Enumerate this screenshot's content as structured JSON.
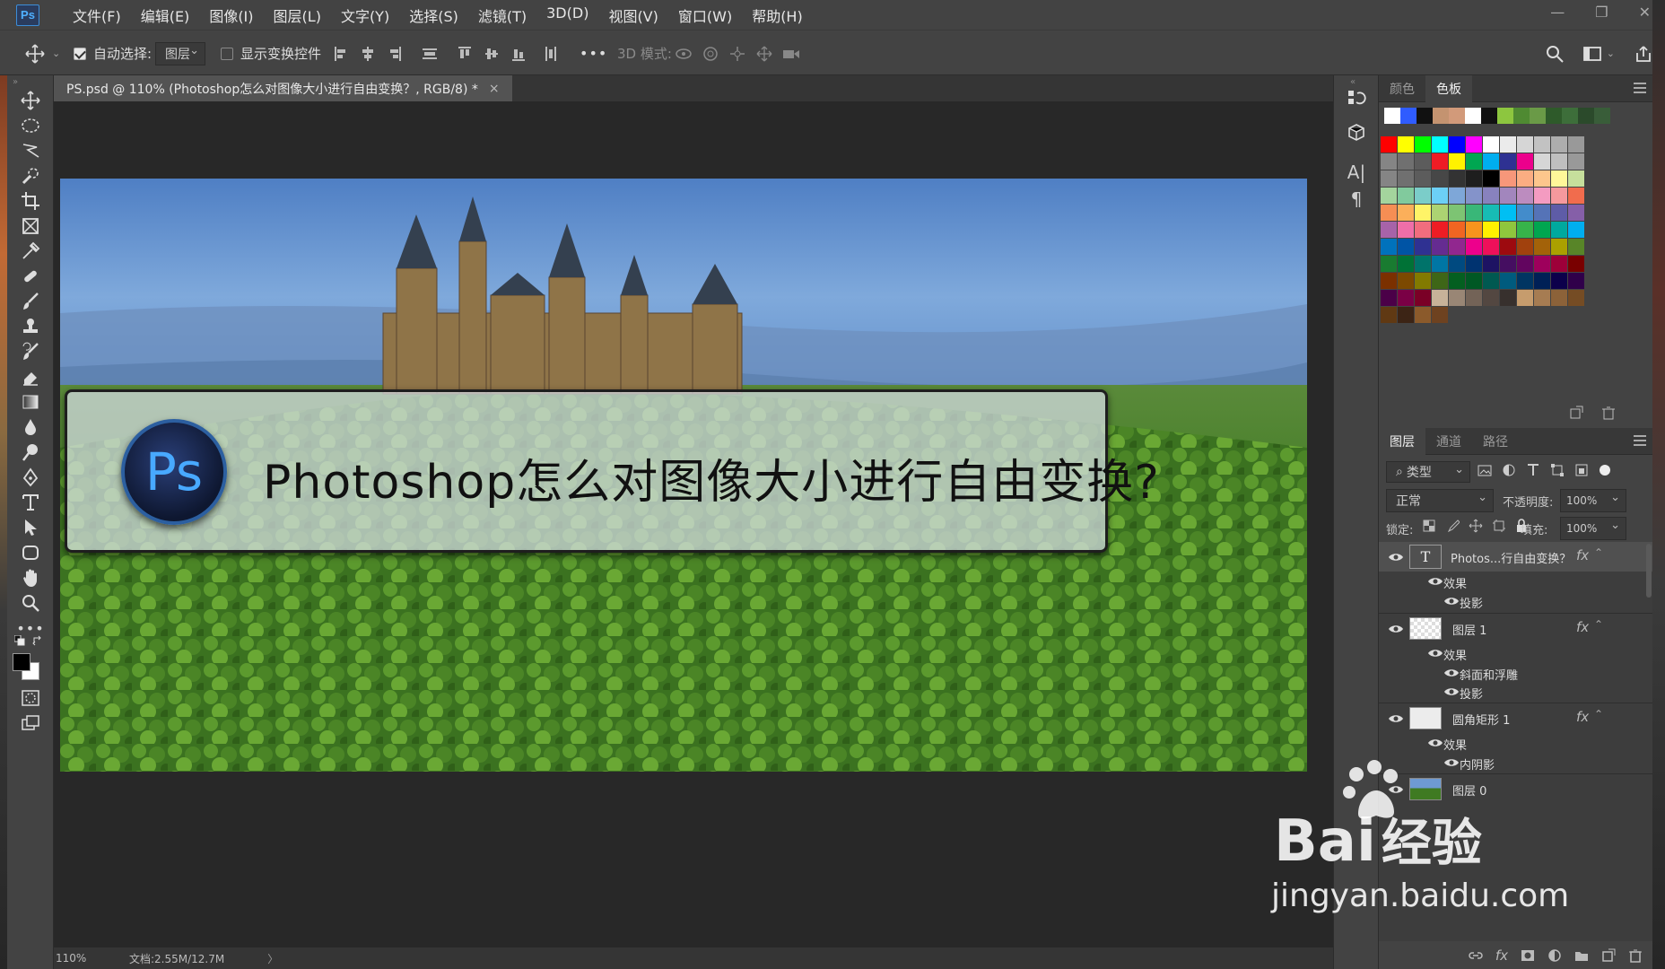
{
  "app": {
    "logo": "Ps"
  },
  "menu": [
    "文件(F)",
    "编辑(E)",
    "图像(I)",
    "图层(L)",
    "文字(Y)",
    "选择(S)",
    "滤镜(T)",
    "3D(D)",
    "视图(V)",
    "窗口(W)",
    "帮助(H)"
  ],
  "options": {
    "auto_select_label": "自动选择:",
    "auto_select_value": "图层",
    "show_transform_label": "显示变换控件",
    "more": "•••",
    "mode_3d_label": "3D 模式:"
  },
  "document": {
    "tab_title": "PS.psd @ 110% (Photoshop怎么对图像大小进行自由变换？, RGB/8) *",
    "tab_close": "×",
    "headline": "Photoshop怎么对图像大小进行自由变换?",
    "badge": "Ps"
  },
  "status": {
    "zoom": "110%",
    "doc_info": "文档:2.55M/12.7M",
    "arrow": "〉"
  },
  "swatches_panel": {
    "tabs": [
      "颜色",
      "色板"
    ],
    "recent": [
      "#ffffff",
      "#2f5cff",
      "#111111",
      "#c49370",
      "#d29a7a",
      "#ffffff",
      "#111111",
      "#8dc63f",
      "#4f8a32",
      "#6a9a47",
      "#2e5a2a",
      "#3d6e3a",
      "#2b4a2b",
      "#395d39"
    ],
    "grid": [
      "#ff0000",
      "#ffff00",
      "#00ff00",
      "#00ffff",
      "#0000ff",
      "#ff00ff",
      "#ffffff",
      "#ebebeb",
      "#d6d6d6",
      "#c2c2c2",
      "#adadad",
      "#999999",
      "#858585",
      "#707070",
      "#5c5c5c",
      "#ee1c25",
      "#fff200",
      "#00a651",
      "#00aeef",
      "#2e3192",
      "#ec008c",
      "#d6d6d6",
      "#bfbfbf",
      "#999999",
      "#858585",
      "#707070",
      "#5c5c5c",
      "#474747",
      "#333333",
      "#1e1e1e",
      "#000000",
      "#f7977a",
      "#fbad82",
      "#fdc68c",
      "#fff799",
      "#c6df9c",
      "#a4d49d",
      "#81ca9d",
      "#7bcdc9",
      "#6ccff6",
      "#7ea7d8",
      "#8493ca",
      "#8882be",
      "#a286bd",
      "#bc8cbf",
      "#f49bc1",
      "#f5999d",
      "#f16c4d",
      "#f68e54",
      "#fbaf5a",
      "#fff467",
      "#acd372",
      "#7dc473",
      "#39b778",
      "#17bcb4",
      "#00bff3",
      "#438ccb",
      "#5573b7",
      "#5e5ca7",
      "#855fa8",
      "#a763a9",
      "#ef6ea8",
      "#f16d7e",
      "#ee1d24",
      "#f16522",
      "#f7941d",
      "#fff100",
      "#8fc63d",
      "#37b44a",
      "#00a650",
      "#00a99e",
      "#00aeef",
      "#0072bc",
      "#0054a5",
      "#2f3192",
      "#652c91",
      "#91278f",
      "#ed008c",
      "#ee105a",
      "#9d0a0f",
      "#a1410d",
      "#a36209",
      "#aba000",
      "#588528",
      "#197b30",
      "#007236",
      "#00736a",
      "#0076a4",
      "#004a80",
      "#003370",
      "#1d1363",
      "#450e61",
      "#62055f",
      "#9e005c",
      "#9d0039",
      "#790000",
      "#7b3000",
      "#7c4900",
      "#827a00",
      "#3e6617",
      "#045f20",
      "#005824",
      "#005951",
      "#005b7e",
      "#003562",
      "#002056",
      "#0c004b",
      "#30004a",
      "#4b0048",
      "#7a0045",
      "#7a0026",
      "#c7b299",
      "#998675",
      "#736357",
      "#534741",
      "#37302d",
      "#c69c6d",
      "#a67c52",
      "#8c6239",
      "#754c24",
      "#603913",
      "#3c2415",
      "#8b5a2b",
      "#6e4220"
    ]
  },
  "layers_panel": {
    "tabs": [
      "图层",
      "通道",
      "路径"
    ],
    "filter_label": "类型",
    "blend_mode": "正常",
    "opacity_label": "不透明度:",
    "opacity_value": "100%",
    "lock_label": "锁定:",
    "fill_label": "填充:",
    "fill_value": "100%",
    "layers": [
      {
        "name": "Photos...行自由变换？",
        "kind": "text",
        "fx": "fx",
        "effects_label": "效果",
        "effects": [
          "投影"
        ]
      },
      {
        "name": "图层 1",
        "kind": "pixel",
        "fx": "fx",
        "effects_label": "效果",
        "effects": [
          "斜面和浮雕",
          "投影"
        ]
      },
      {
        "name": "圆角矩形 1",
        "kind": "shape",
        "fx": "fx",
        "effects_label": "效果",
        "effects": [
          "内阴影"
        ]
      },
      {
        "name": "图层 0",
        "kind": "photo"
      }
    ]
  },
  "watermark": {
    "brand": "Bai",
    "brand2": "经验",
    "url": "jingyan.baidu.com"
  }
}
